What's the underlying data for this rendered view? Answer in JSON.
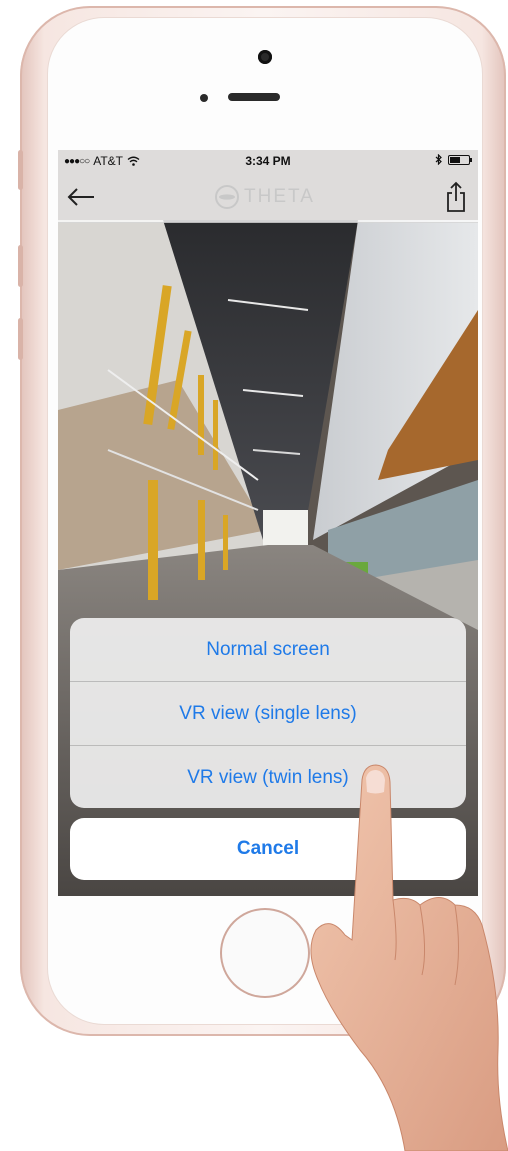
{
  "status_bar": {
    "carrier": "AT&T",
    "time": "3:34 PM"
  },
  "nav": {
    "logo_text": "THETA",
    "back_icon": "back-arrow-icon",
    "share_icon": "share-icon"
  },
  "action_sheet": {
    "options": [
      {
        "label": "Normal screen"
      },
      {
        "label": "VR view (single lens)"
      },
      {
        "label": "VR view (twin lens)"
      }
    ],
    "cancel_label": "Cancel"
  },
  "colors": {
    "accent": "#1f7ae8",
    "phone_body": "#f3dfd9"
  }
}
